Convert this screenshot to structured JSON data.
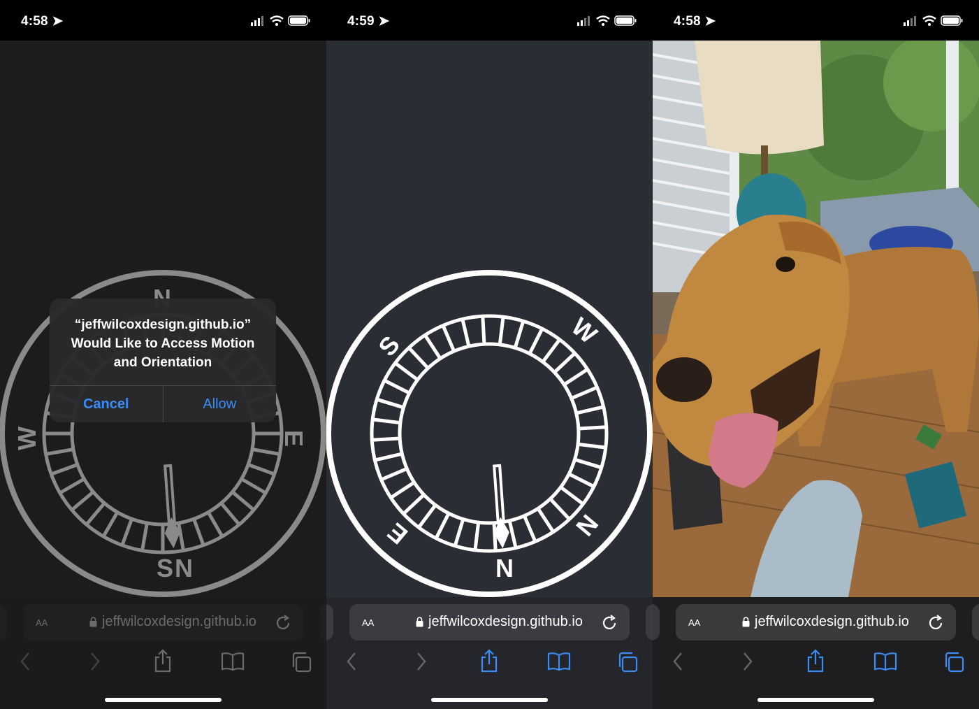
{
  "screens": [
    {
      "status": {
        "time": "4:58"
      },
      "compass": {
        "north": "N",
        "south": "S",
        "east": "E",
        "west": "W",
        "pointer": "N"
      },
      "alert": {
        "title_line1": "“jeffwilcoxdesign.github.io”",
        "title_line2": "Would Like to Access Motion",
        "title_line3": "and Orientation",
        "cancel": "Cancel",
        "allow": "Allow"
      },
      "toolbar": {
        "text_size": "AA",
        "url": "jeffwilcoxdesign.github.io"
      }
    },
    {
      "status": {
        "time": "4:59"
      },
      "compass": {
        "north": "N",
        "south": "S",
        "east": "E",
        "west": "W",
        "pointer": "N"
      },
      "toolbar": {
        "text_size": "AA",
        "url": "jeffwilcoxdesign.github.io"
      }
    },
    {
      "status": {
        "time": "4:58"
      },
      "photo": {
        "subject": "camera-view-dog"
      },
      "toolbar": {
        "text_size": "AA",
        "url": "jeffwilcoxdesign.github.io"
      }
    }
  ],
  "colors": {
    "accent": "#3b8cf3",
    "compass_dim": "#8a8a8c",
    "compass_bright": "#ffffff"
  }
}
